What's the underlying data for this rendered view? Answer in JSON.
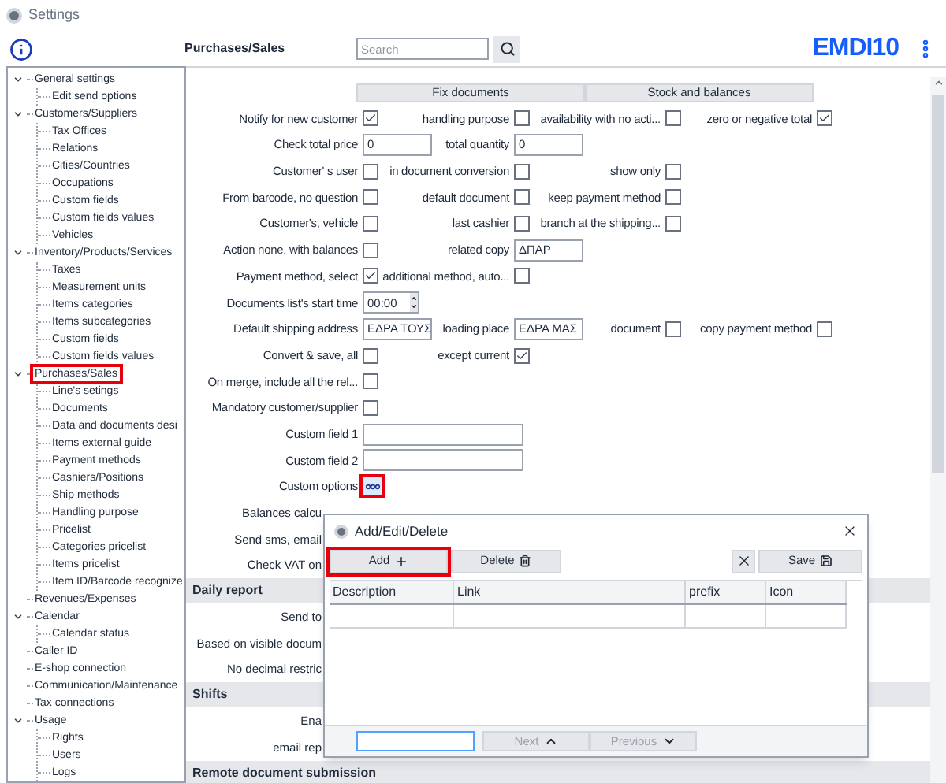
{
  "window": {
    "title": "Settings"
  },
  "header": {
    "title": "Purchases/Sales",
    "search": {
      "placeholder": "Search"
    },
    "logo": "EMDI10"
  },
  "sidebar": {
    "items": [
      {
        "label": "General settings",
        "expanded": true,
        "highlighted": false,
        "children": [
          {
            "label": "Edit send options",
            "highlighted": false
          }
        ]
      },
      {
        "label": "Customers/Suppliers",
        "expanded": true,
        "highlighted": false,
        "children": [
          {
            "label": "Tax Offices",
            "highlighted": false
          },
          {
            "label": "Relations",
            "highlighted": false
          },
          {
            "label": "Cities/Countries",
            "highlighted": false
          },
          {
            "label": "Occupations",
            "highlighted": false
          },
          {
            "label": "Custom fields",
            "highlighted": false
          },
          {
            "label": "Custom fields values",
            "highlighted": false
          },
          {
            "label": "Vehicles",
            "highlighted": false
          }
        ]
      },
      {
        "label": "Inventory/Products/Services",
        "expanded": true,
        "highlighted": false,
        "children": [
          {
            "label": "Taxes",
            "highlighted": false
          },
          {
            "label": "Measurement units",
            "highlighted": false
          },
          {
            "label": "Items categories",
            "highlighted": false
          },
          {
            "label": "Items subcategories",
            "highlighted": false
          },
          {
            "label": "Custom fields",
            "highlighted": false
          },
          {
            "label": "Custom fields values",
            "highlighted": false
          }
        ]
      },
      {
        "label": "Purchases/Sales",
        "expanded": true,
        "highlighted": true,
        "children": [
          {
            "label": "Line's setings",
            "highlighted": false
          },
          {
            "label": "Documents",
            "highlighted": false
          },
          {
            "label": "Data and documents desi",
            "highlighted": false
          },
          {
            "label": "Items external guide",
            "highlighted": false
          },
          {
            "label": "Payment methods",
            "highlighted": false
          },
          {
            "label": "Cashiers/Positions",
            "highlighted": false
          },
          {
            "label": "Ship methods",
            "highlighted": false
          },
          {
            "label": "Handling purpose",
            "highlighted": false
          },
          {
            "label": "Pricelist",
            "highlighted": false
          },
          {
            "label": "Categories pricelist",
            "highlighted": false
          },
          {
            "label": "Items pricelist",
            "highlighted": false
          },
          {
            "label": "Item ID/Barcode recognize",
            "highlighted": false
          }
        ]
      },
      {
        "label": "Revenues/Expenses",
        "highlighted": false
      },
      {
        "label": "Calendar",
        "expanded": true,
        "highlighted": false,
        "children": [
          {
            "label": "Calendar status",
            "highlighted": false
          }
        ]
      },
      {
        "label": "Caller ID",
        "highlighted": false
      },
      {
        "label": "E-shop connection",
        "highlighted": false
      },
      {
        "label": "Communication/Maintenance",
        "highlighted": false
      },
      {
        "label": "Tax connections",
        "highlighted": false
      },
      {
        "label": "Usage",
        "expanded": true,
        "highlighted": false,
        "children": [
          {
            "label": "Rights",
            "highlighted": false
          },
          {
            "label": "Users",
            "highlighted": false
          },
          {
            "label": "Logs",
            "highlighted": false
          }
        ]
      }
    ]
  },
  "section_buttons": [
    "Fix documents",
    "Stock and balances"
  ],
  "form": {
    "rows": [
      {
        "kind": "fields",
        "items": [
          {
            "label": "Notify for new customer",
            "kind": "checkbox",
            "checked": true
          },
          {
            "label": "handling purpose",
            "kind": "checkbox",
            "checked": false
          },
          {
            "label": "availability with no acti...",
            "kind": "checkbox",
            "checked": false
          },
          {
            "label": "zero or negative total",
            "kind": "checkbox",
            "checked": true
          }
        ]
      },
      {
        "kind": "fields",
        "items": [
          {
            "label": "Check total price",
            "kind": "text",
            "value": "0"
          },
          {
            "label": "total quantity",
            "kind": "text",
            "value": "0"
          }
        ]
      },
      {
        "kind": "fields",
        "items": [
          {
            "label": "Customer' s user",
            "kind": "checkbox",
            "checked": false
          },
          {
            "label": "in document conversion",
            "kind": "checkbox",
            "checked": false
          },
          {
            "label": "show only",
            "kind": "checkbox",
            "checked": false
          }
        ]
      },
      {
        "kind": "fields",
        "items": [
          {
            "label": "From barcode, no question",
            "kind": "checkbox",
            "checked": false
          },
          {
            "label": "default document",
            "kind": "checkbox",
            "checked": false
          },
          {
            "label": "keep payment method",
            "kind": "checkbox",
            "checked": false
          }
        ]
      },
      {
        "kind": "fields",
        "items": [
          {
            "label": "Customer's, vehicle",
            "kind": "checkbox",
            "checked": false
          },
          {
            "label": "last cashier",
            "kind": "checkbox",
            "checked": false
          },
          {
            "label": "branch at the shipping...",
            "kind": "checkbox",
            "checked": false
          }
        ]
      },
      {
        "kind": "fields",
        "items": [
          {
            "label": "Action none, with balances",
            "kind": "checkbox",
            "checked": false
          },
          {
            "label": "related copy",
            "kind": "text",
            "value": "ΔΠΑΡ"
          }
        ]
      },
      {
        "kind": "fields",
        "items": [
          {
            "label": "Payment method, select",
            "kind": "checkbox",
            "checked": true
          },
          {
            "label": "additional method, auto...",
            "kind": "checkbox",
            "checked": false
          }
        ]
      },
      {
        "kind": "fields",
        "items": [
          {
            "label": "Documents list's start time",
            "kind": "time",
            "value": "00:00"
          }
        ]
      },
      {
        "kind": "fields",
        "items": [
          {
            "label": "Default shipping address",
            "kind": "text",
            "value": "ΕΔΡΑ ΤΟΥΣ"
          },
          {
            "label": "loading place",
            "kind": "text",
            "value": "ΕΔΡΑ ΜΑΣ"
          },
          {
            "label": "document",
            "kind": "checkbox",
            "checked": false
          },
          {
            "label": "copy payment method",
            "kind": "checkbox",
            "checked": false
          }
        ]
      },
      {
        "kind": "fields",
        "items": [
          {
            "label": "Convert & save, all",
            "kind": "checkbox",
            "checked": false
          },
          {
            "label": "except current",
            "kind": "checkbox",
            "checked": true
          }
        ]
      },
      {
        "kind": "fields",
        "items": [
          {
            "label": "On merge, include all the rel...",
            "kind": "checkbox",
            "checked": false
          }
        ]
      },
      {
        "kind": "fields",
        "items": [
          {
            "label": "Mandatory customer/supplier",
            "kind": "checkbox",
            "checked": false
          }
        ]
      },
      {
        "kind": "fields",
        "items": [
          {
            "label": "Custom field 1",
            "kind": "wide_text"
          }
        ]
      },
      {
        "kind": "fields",
        "items": [
          {
            "label": "Custom field 2",
            "kind": "wide_text"
          }
        ]
      },
      {
        "kind": "fields",
        "items": [
          {
            "label": "Custom options",
            "kind": "more_button",
            "highlighted": true
          }
        ]
      },
      {
        "kind": "covered",
        "label": "Balances calcu"
      },
      {
        "kind": "covered",
        "label": "Send sms, email"
      },
      {
        "kind": "covered",
        "label": "Check VAT on"
      },
      {
        "kind": "header",
        "label": "Daily report"
      },
      {
        "kind": "covered",
        "label": "Send to"
      },
      {
        "kind": "covered",
        "label": "Based on visible docum"
      },
      {
        "kind": "covered",
        "label": "No decimal restric"
      },
      {
        "kind": "header",
        "label": "Shifts"
      },
      {
        "kind": "covered",
        "label": "Ena"
      },
      {
        "kind": "covered",
        "label": "email rep"
      },
      {
        "kind": "header",
        "label": "Remote document submission"
      }
    ]
  },
  "dialog": {
    "title": "Add/Edit/Delete",
    "buttons": [
      {
        "label": "Add",
        "kind": "add",
        "highlighted": true
      },
      {
        "label": "Delete",
        "kind": "delete",
        "highlighted": false
      }
    ],
    "save": "Save",
    "table": {
      "columns": [
        "Description",
        "Link",
        "prefix",
        "Icon"
      ]
    },
    "nav": [
      {
        "label": "Next",
        "kind": "up",
        "disabled": true
      },
      {
        "label": "Previous",
        "kind": "down",
        "disabled": true
      }
    ]
  }
}
